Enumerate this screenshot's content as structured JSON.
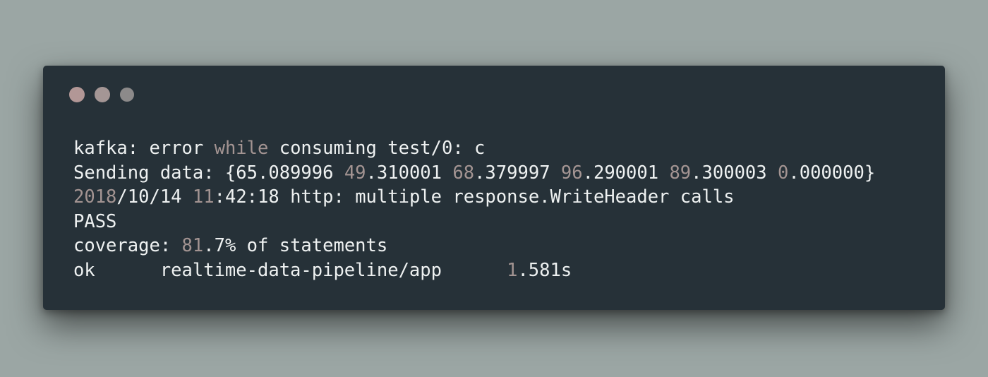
{
  "window": {
    "controls": [
      {
        "name": "close-button",
        "color": "#b29796"
      },
      {
        "name": "minimize-button",
        "color": "#a49695"
      },
      {
        "name": "zoom-button",
        "color": "#8c8a8a"
      }
    ]
  },
  "terminal": {
    "colors": {
      "background": "#263138",
      "text": "#eef1f1",
      "number_highlight": "#a39492"
    },
    "lines": [
      [
        {
          "text": "kafka: error ",
          "style": "normal"
        },
        {
          "text": "while",
          "style": "dim"
        },
        {
          "text": " consuming test/0: c",
          "style": "normal"
        }
      ],
      [
        {
          "text": "Sending data: {65.089996 ",
          "style": "normal"
        },
        {
          "text": "49",
          "style": "dim"
        },
        {
          "text": ".310001 ",
          "style": "normal"
        },
        {
          "text": "68",
          "style": "dim"
        },
        {
          "text": ".379997 ",
          "style": "normal"
        },
        {
          "text": "96",
          "style": "dim"
        },
        {
          "text": ".290001 ",
          "style": "normal"
        },
        {
          "text": "89",
          "style": "dim"
        },
        {
          "text": ".300003 ",
          "style": "normal"
        },
        {
          "text": "0",
          "style": "dim"
        },
        {
          "text": ".000000}",
          "style": "normal"
        }
      ],
      [
        {
          "text": "2018",
          "style": "dim"
        },
        {
          "text": "/10/14 ",
          "style": "normal"
        },
        {
          "text": "11",
          "style": "dim"
        },
        {
          "text": ":42:18 http: multiple response.WriteHeader calls",
          "style": "normal"
        }
      ],
      [
        {
          "text": "PASS",
          "style": "normal"
        }
      ],
      [
        {
          "text": "coverage: ",
          "style": "normal"
        },
        {
          "text": "81",
          "style": "dim"
        },
        {
          "text": ".7% of statements",
          "style": "normal"
        }
      ],
      [
        {
          "text": "ok      realtime-data-pipeline/app      ",
          "style": "normal"
        },
        {
          "text": "1",
          "style": "dim"
        },
        {
          "text": ".581s",
          "style": "normal"
        }
      ]
    ]
  }
}
